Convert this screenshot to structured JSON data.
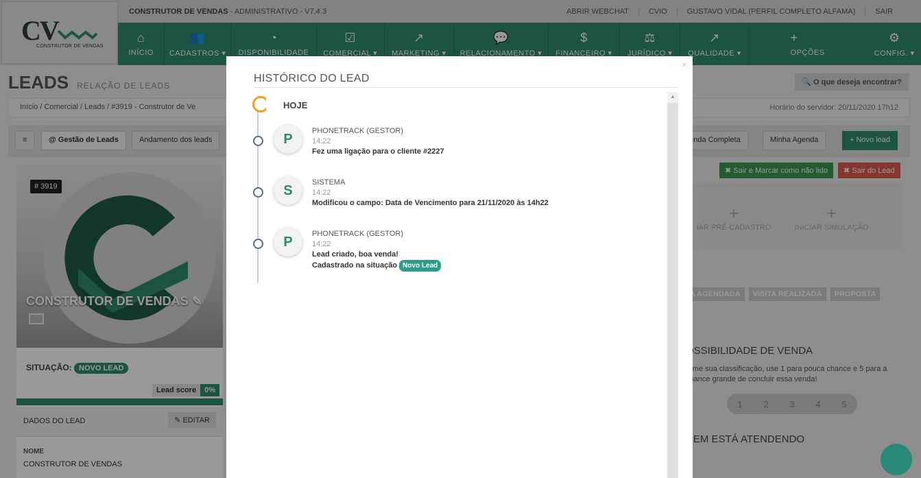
{
  "app": {
    "logo_text": "CV",
    "logo_sub": "CONSTRUTOR DE VENDAS",
    "system_name": "CONSTRUTOR DE VENDAS",
    "system_suffix": " - ADMINISTRATIVO - V7.4.3"
  },
  "toplinks": [
    "ABRIR WEBCHAT",
    "CVIO",
    "GUSTAVO VIDAL (PERFIL COMPLETO ALFAMA)",
    "SAIR"
  ],
  "menu": [
    {
      "label": "INÍCIO",
      "icon": "⌂"
    },
    {
      "label": "CADASTROS ▾",
      "icon": "👥"
    },
    {
      "label": "DISPONIBILIDADE",
      "icon": "◔"
    },
    {
      "label": "COMERCIAL ▾",
      "icon": "☑"
    },
    {
      "label": "MARKETING ▾",
      "icon": "↗"
    },
    {
      "label": "RELACIONAMENTO ▾",
      "icon": "💬"
    },
    {
      "label": "FINANCEIRO ▾",
      "icon": "$"
    },
    {
      "label": "JURÍDICO ▾",
      "icon": "⚖"
    },
    {
      "label": "QUALIDADE ▾",
      "icon": "↗"
    },
    {
      "label": "OPÇÕES",
      "icon": "+"
    },
    {
      "label": "CONFIG. ▾",
      "icon": "⚙"
    }
  ],
  "page": {
    "title": "LEADS",
    "subtitle": "RELAÇÃO DE LEADS",
    "search": "O que deseja encontrar?"
  },
  "breadcrumb": {
    "path": "Início  /  Comercial  /  Leads  /  #3919 - Construtor de Ve",
    "server_time": "Horário do servidor: 20/11/2020 17h12"
  },
  "toolbar": {
    "menu": "≡",
    "gestao": "@ Gestão de Leads",
    "andamento": "Andamento dos leads",
    "agenda_completa": "genda Completa",
    "minha_agenda": "Minha Agenda",
    "novo_lead": "+ Novo lead"
  },
  "lead": {
    "id": "# 3919",
    "name": "CONSTRUTOR DE VENDAS",
    "situacao_label": "SITUAÇÃO:",
    "situacao": "NOVO LEAD",
    "score_label": "Lead score",
    "score": "0%",
    "dados": "DADOS DO LEAD",
    "editar": "EDITAR",
    "nome_label": "NOME",
    "nome": "CONSTRUTOR DE VENDAS"
  },
  "right": {
    "sair_marcar": "Sair e Marcar como não lido",
    "sair_lead": "Sair do Lead",
    "pre_cadastro": "IAR PRÉ-CADASTRO",
    "simulacao": "INICIAR SIMULAÇÃO",
    "steps": [
      "TA AGENDADA",
      "VISITA REALIZADA",
      "PROPOSTA"
    ],
    "poss_title": "OSSIBILIDADE DE VENDA",
    "poss_text": "orme sua classificação, use 1 para pouca chance e 5 para a chance grande de concluir essa venda!",
    "ratings": [
      "1",
      "2",
      "3",
      "4",
      "5"
    ],
    "atend_title": "UEM ESTÁ ATENDENDO"
  },
  "modal": {
    "title": "HISTÓRICO DO LEAD",
    "hoje": "HOJE",
    "events": [
      {
        "author": "PHONETRACK (GESTOR)",
        "time": "14:22",
        "desc": "Fez uma ligação para o cliente #2227",
        "icon": "P"
      },
      {
        "author": "SISTEMA",
        "time": "14:22",
        "desc": "Modificou o campo: Data de Vencimento para 21/11/2020 às 14h22",
        "icon": "S"
      },
      {
        "author": "PHONETRACK (GESTOR)",
        "time": "14:22",
        "desc": "Lead criado, boa venda!",
        "desc2": "Cadastrado na situação",
        "badge": "Novo Lead",
        "icon": "P"
      }
    ]
  },
  "colors": {
    "brand": "#2f8c6b",
    "accent": "#f0a020"
  }
}
